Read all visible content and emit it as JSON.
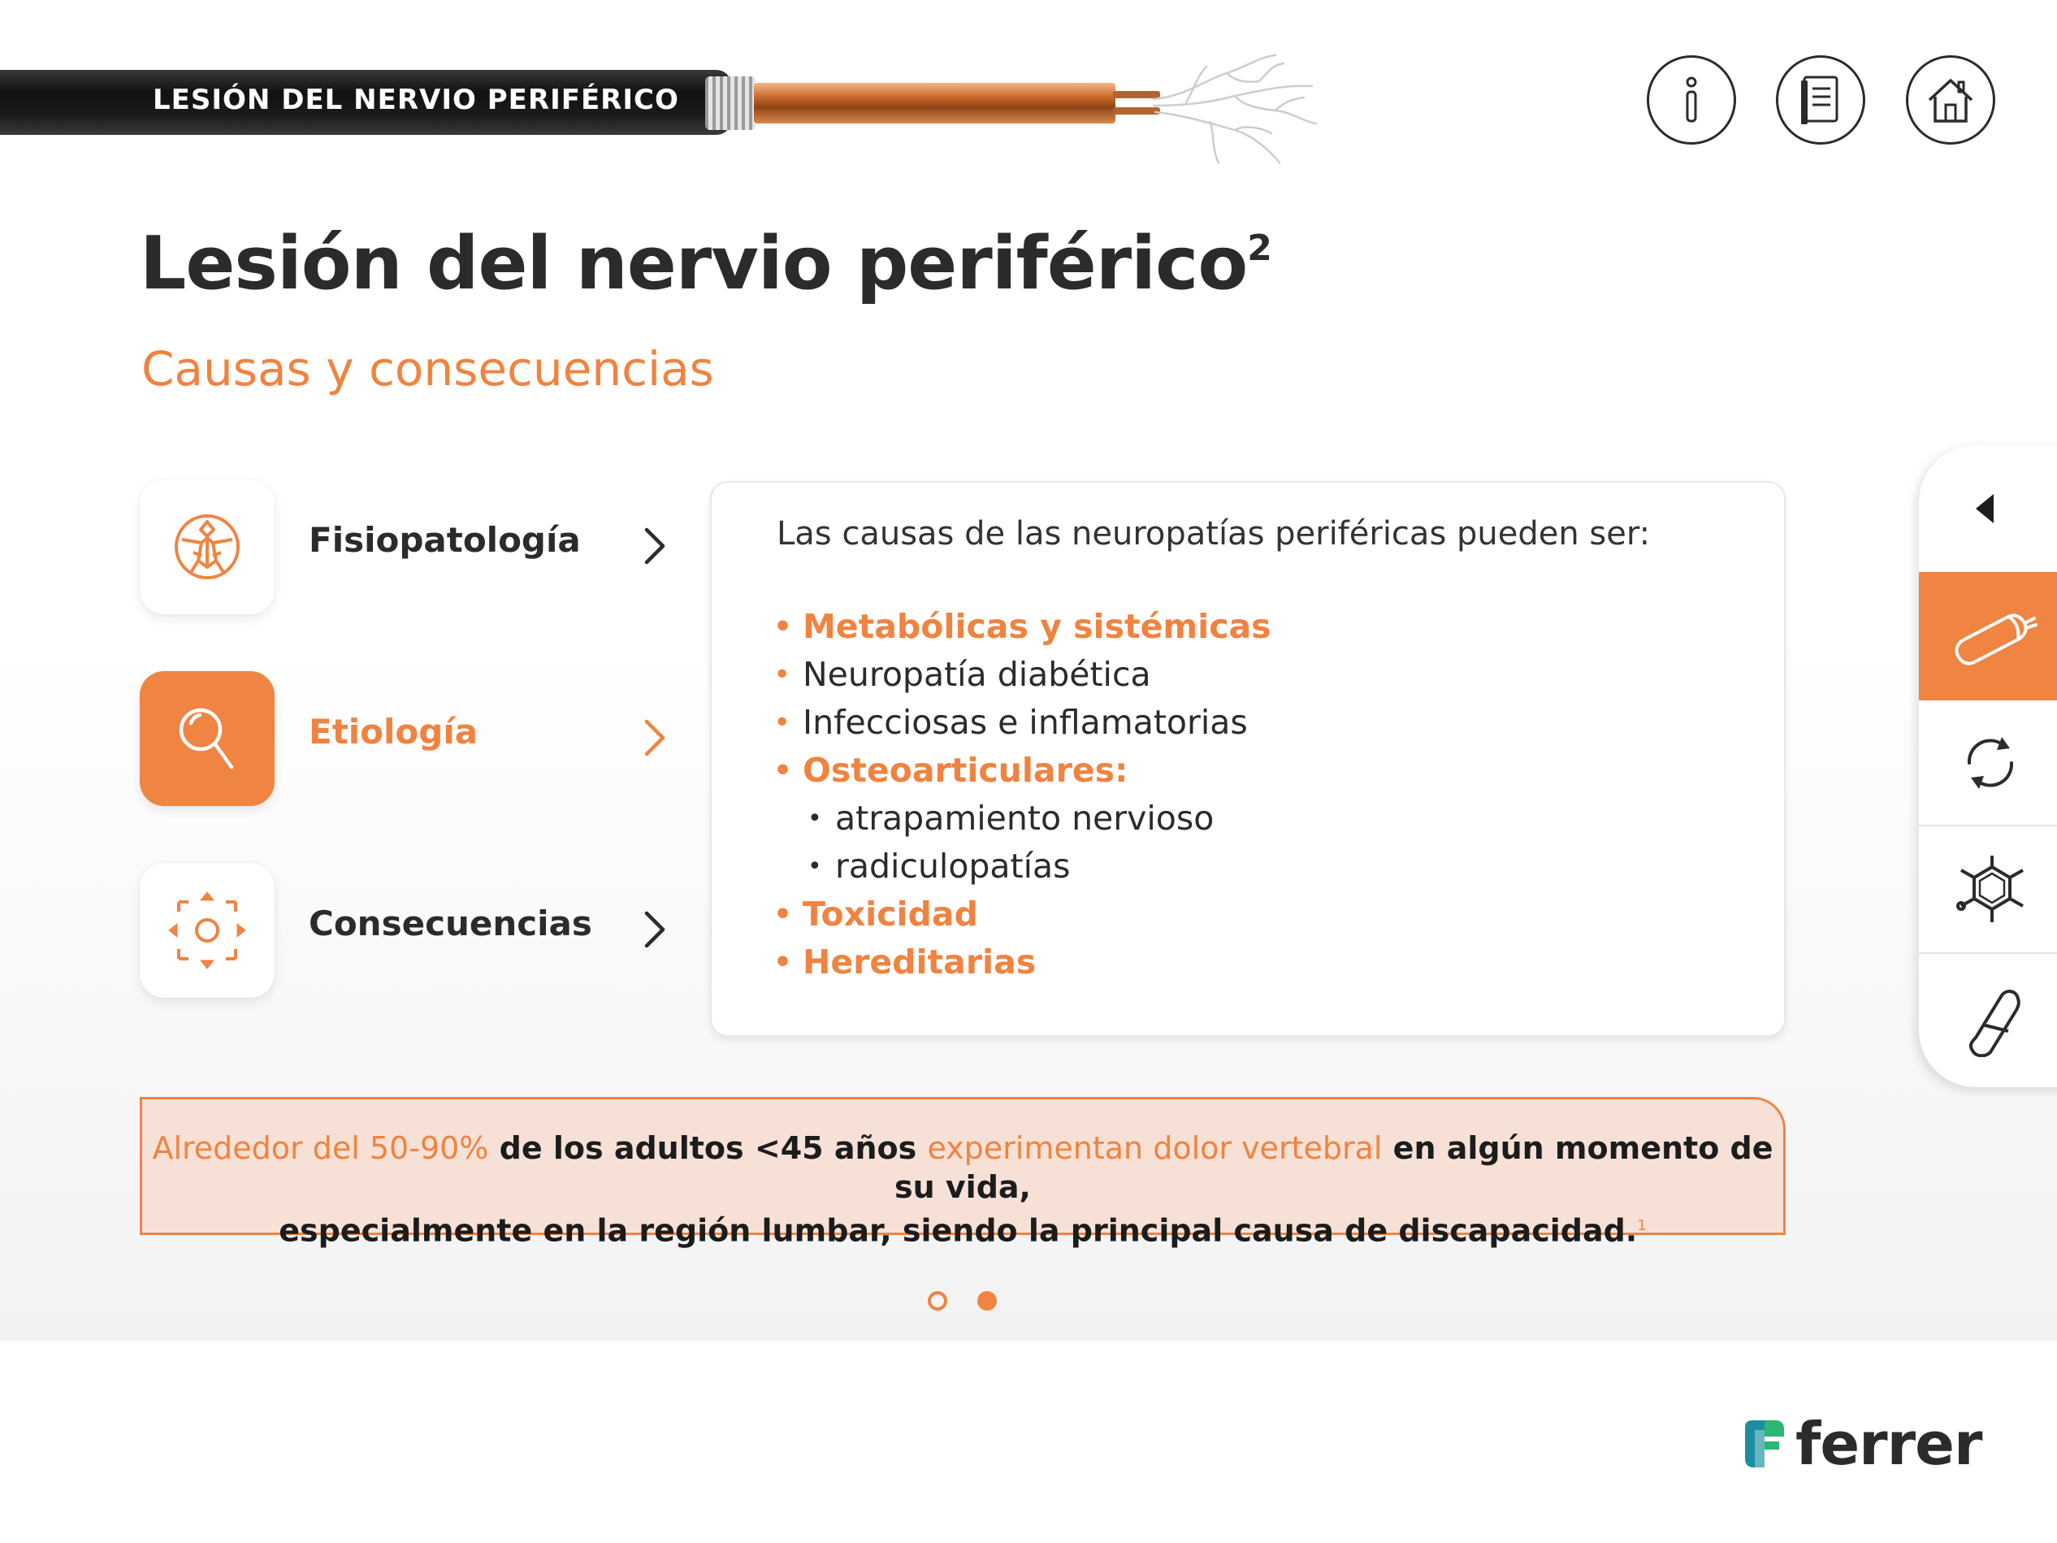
{
  "header": {
    "cable_title": "LESIÓN DEL NERVIO PERIFÉRICO"
  },
  "top_icons": [
    {
      "name": "info-icon"
    },
    {
      "name": "book-icon"
    },
    {
      "name": "home-icon"
    }
  ],
  "page": {
    "title": "Lesión del nervio periférico",
    "title_sup": "2",
    "subtitle": "Causas y consecuencias"
  },
  "menu": [
    {
      "label": "Fisiopatología",
      "icon": "human-body-icon",
      "active": false
    },
    {
      "label": "Etiología",
      "icon": "magnifier-icon",
      "active": true
    },
    {
      "label": "Consecuencias",
      "icon": "radiate-arrows-icon",
      "active": false
    }
  ],
  "panel": {
    "intro": "Las causas de las neuropatías periféricas pueden ser:",
    "items": [
      {
        "text": "Metabólicas y sistémicas",
        "style": "hl"
      },
      {
        "text": "Neuropatía diabética",
        "style": "normal"
      },
      {
        "text": "Infecciosas e inflamatorias",
        "style": "normal"
      },
      {
        "text": "Osteoarticulares:",
        "style": "hl"
      },
      {
        "text": "atrapamiento nervioso",
        "style": "sub"
      },
      {
        "text": "radiculopatías",
        "style": "sub"
      },
      {
        "text": "Toxicidad",
        "style": "hl"
      },
      {
        "text": "Hereditarias",
        "style": "hl"
      }
    ]
  },
  "sidenav": [
    {
      "name": "collapse-arrow-icon"
    },
    {
      "name": "nerve-cable-icon",
      "active": true
    },
    {
      "name": "cycle-arrows-icon"
    },
    {
      "name": "molecule-icon"
    },
    {
      "name": "capsule-icon"
    }
  ],
  "banner": {
    "p1_orange": "Alrededor del 50-90%",
    "p1_dark": " de los adultos <45 años ",
    "p1_orange2": "experimentan dolor vertebral",
    "p1_dark2": " en algún momento de su vida,",
    "p2": "especialmente en la región lumbar, siendo la principal causa de discapacidad.",
    "p2_sup": "1"
  },
  "pager": {
    "current": 2,
    "total": 2
  },
  "logo": {
    "text": "ferrer"
  },
  "colors": {
    "accent": "#ef8443",
    "text": "#2b2b2b",
    "banner_bg": "#f7e1d6",
    "logo_teal": "#1a8fa0",
    "logo_green": "#2bb673"
  }
}
